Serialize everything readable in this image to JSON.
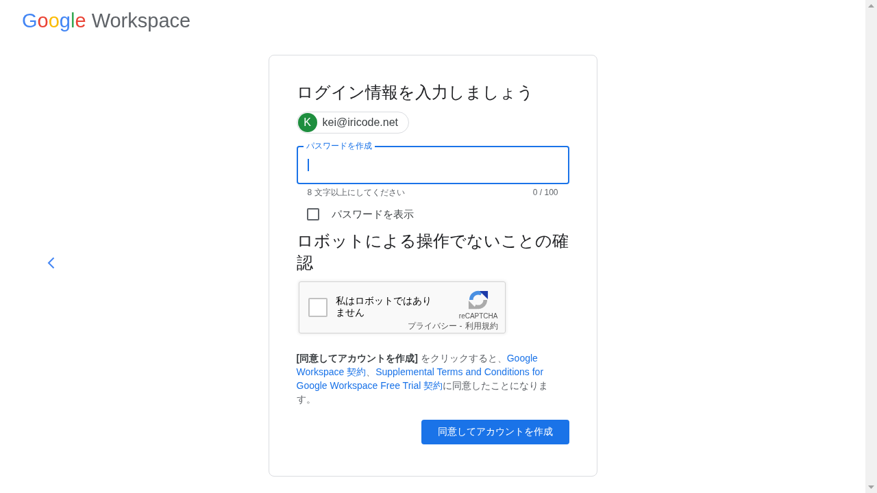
{
  "logo": {
    "brand": "Google",
    "product": "Workspace"
  },
  "card": {
    "title": "ログイン情報を入力しましょう",
    "account_chip": {
      "initial": "K",
      "email": "kei@iricode.net"
    },
    "password_field": {
      "label": "パスワードを作成",
      "focused": true,
      "helper": "8 文字以上にしてください",
      "counter": "0 / 100"
    },
    "show_password": {
      "label": "パスワードを表示",
      "checked": false
    },
    "captcha_heading": "ロボットによる操作でないことの確認",
    "captcha": {
      "label": "私はロボットではありません",
      "checked": false,
      "brand": "reCAPTCHA",
      "privacy_link": "プライバシー",
      "separator": "-",
      "terms_link": "利用規約"
    },
    "terms": [
      {
        "kind": "bold",
        "text": "[同意してアカウントを作成]"
      },
      {
        "kind": "text",
        "text": " をクリックすると、"
      },
      {
        "kind": "link",
        "parts": [
          "Google",
          "Workspace 契約"
        ]
      },
      {
        "kind": "text",
        "text": "、"
      },
      {
        "kind": "link",
        "parts": [
          "Supplemental Terms and Conditions for",
          "Google Workspace Free Trial 契約"
        ]
      },
      {
        "kind": "text",
        "text": "に同意したことになります。"
      }
    ],
    "submit_button": "同意してアカウントを作成"
  }
}
